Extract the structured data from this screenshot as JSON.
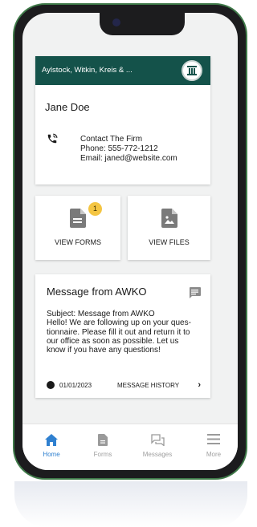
{
  "firm": {
    "name": "Aylstock, Witkin, Kreis & ..."
  },
  "client": {
    "name": "Jane Doe"
  },
  "contact": {
    "heading": "Contact The Firm",
    "phone": "Phone: 555-772-1212",
    "email": "Email: janed@website.com"
  },
  "actions": {
    "forms_label": "VIEW FORMS",
    "forms_badge": "1",
    "files_label": "VIEW FILES"
  },
  "message": {
    "title": "Message from AWKO",
    "subject": "Subject: Message from AWKO",
    "body_lines": [
      "Hello! We are following up on your ques-",
      "tionnaire. Please fill it out and return it to",
      "our office as soon as possible. Let us",
      "know if you have any questions!"
    ],
    "date": "01/01/2023",
    "history_label": "MESSAGE HISTORY"
  },
  "tabs": [
    {
      "label": "Home",
      "icon": "home-icon",
      "active": true
    },
    {
      "label": "Forms",
      "icon": "document-icon",
      "active": false
    },
    {
      "label": "Messages",
      "icon": "chat-icon",
      "active": false
    },
    {
      "label": "More",
      "icon": "menu-icon",
      "active": false
    }
  ],
  "colors": {
    "header": "#14524a",
    "badge": "#f4c542",
    "active_tab": "#2f80d0",
    "inactive_tab": "#a0a0a0"
  }
}
